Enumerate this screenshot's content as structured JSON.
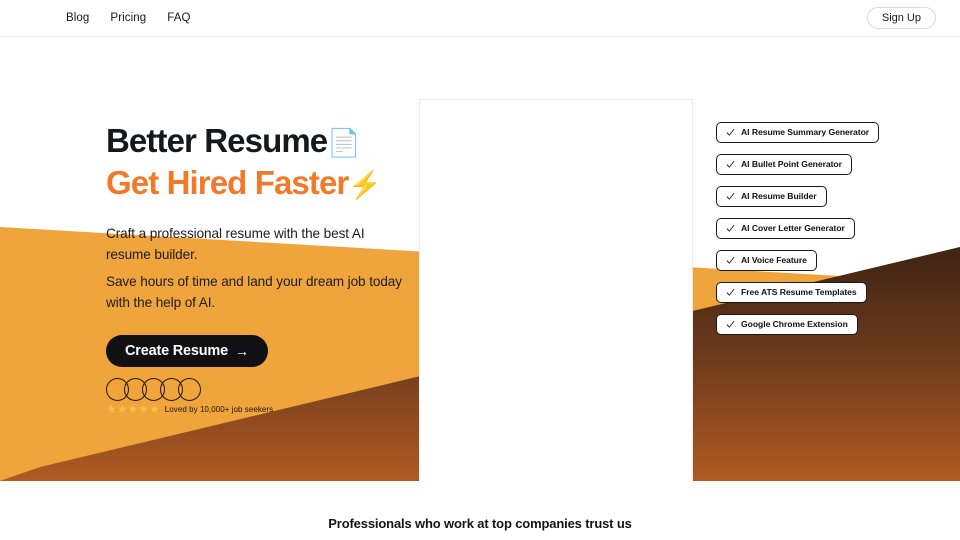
{
  "header": {
    "nav": [
      {
        "label": "Blog"
      },
      {
        "label": "Pricing"
      },
      {
        "label": "FAQ"
      }
    ],
    "signup_label": "Sign Up"
  },
  "hero": {
    "headline_line1": "Better Resume",
    "headline_line1_emoji": "📄",
    "headline_line2": "Get Hired Faster",
    "headline_line2_emoji": "⚡",
    "paragraph_1": "Craft a professional resume with the best AI resume builder.",
    "paragraph_2": "Save hours of time and land your dream job today with the help of AI.",
    "cta_label": "Create Resume",
    "cta_arrow": "→",
    "social_proof": {
      "avatar_count": 5,
      "stars": "★★★★★",
      "star_count": 5,
      "loved_text": "Loved by 10,000+ job seekers"
    }
  },
  "features": [
    {
      "label": "AI Resume Summary Generator"
    },
    {
      "label": "AI Bullet Point Generator"
    },
    {
      "label": "AI Resume Builder"
    },
    {
      "label": "AI Cover Letter Generator"
    },
    {
      "label": "AI Voice Feature"
    },
    {
      "label": "Free ATS Resume Templates"
    },
    {
      "label": "Google Chrome Extension"
    }
  ],
  "trust_section": {
    "heading": "Professionals who work at top companies trust us"
  },
  "colors": {
    "accent_orange": "#F07A28",
    "band_orange": "#EFA43C",
    "band_brown_dark": "#4A2A18",
    "band_brown_light": "#B05A22",
    "text_dark": "#17181A",
    "cta_background": "#111113",
    "star_yellow": "#F5C243"
  }
}
